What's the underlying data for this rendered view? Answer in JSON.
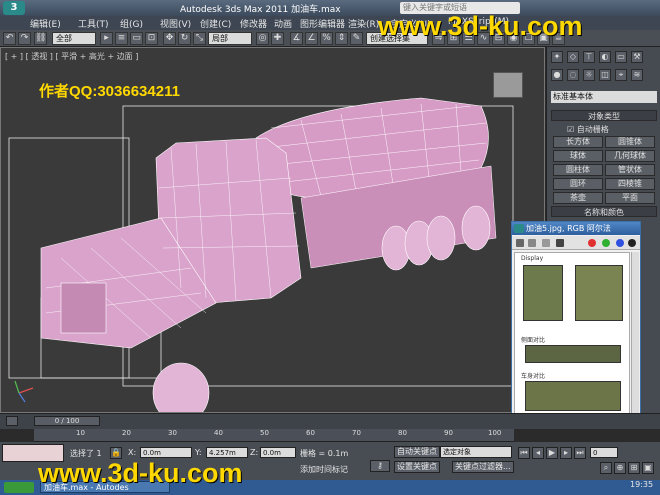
{
  "titlebar": {
    "logo": "3",
    "title": "Autodesk 3ds Max  2011       加油车.max",
    "search_placeholder": "键入关键字或短语"
  },
  "watermark": {
    "top": "www.3d-ku.com",
    "bottom": "www.3d-ku.com"
  },
  "menus": [
    "编辑(E)",
    "工具(T)",
    "组(G)",
    "视图(V)",
    "创建(C)",
    "修改器",
    "动画",
    "图形编辑器",
    "渲染(R)",
    "自定义(U)",
    "MAXScript(M)"
  ],
  "toolbar": {
    "filter_value": "全部",
    "coord_value": "局部",
    "named_set": "创建选择集"
  },
  "viewport": {
    "label": "[ + ] [ 透视 ] [ 平滑 + 高光 + 边面 ]",
    "author": "作者QQ:3036634211"
  },
  "command_panel": {
    "category": "标准基本体",
    "object_type_header": "对象类型",
    "auto_grid": "自动栅格",
    "buttons": [
      "长方体",
      "圆锥体",
      "球体",
      "几何球体",
      "圆柱体",
      "管状体",
      "圆环",
      "四棱锥",
      "茶壶",
      "平面"
    ],
    "name_color_header": "名称和颜色"
  },
  "image_window": {
    "title": "加油5.jpg, RGB 阿尔法",
    "caption_top": "Display",
    "caption_mid": "侧面对比",
    "caption_low": "车身对比"
  },
  "timeline": {
    "position": "0 / 100",
    "ticks": [
      "10",
      "20",
      "30",
      "40",
      "50",
      "60",
      "70",
      "80",
      "90",
      "100"
    ]
  },
  "status": {
    "selected": "选择了 1",
    "x_value": "0.0m",
    "y_value": "4.257m",
    "z_value": "0.0m",
    "grid": "栅格 = 0.1m",
    "auto_key": "自动关键点",
    "selected_obj": "选定对象",
    "set_key": "设置关键点",
    "key_filter": "关键点过滤器...",
    "add_time_tag": "添加时间标记",
    "frame": "0",
    "taskbar_item": "加油车.max - Autodes"
  },
  "clock": "19:35",
  "colors": {
    "mesh": "#e6a9d6",
    "watermark": "#ffd800",
    "background": "#3a3a3a"
  }
}
